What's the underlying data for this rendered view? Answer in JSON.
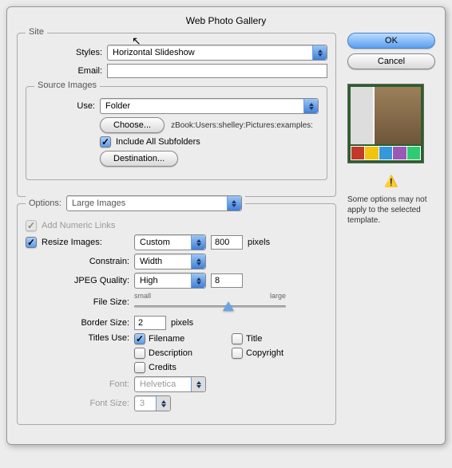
{
  "window_title": "Web Photo Gallery",
  "buttons": {
    "ok": "OK",
    "cancel": "Cancel"
  },
  "site": {
    "legend": "Site",
    "styles_label": "Styles:",
    "styles_value": "Horizontal Slideshow",
    "email_label": "Email:",
    "email_value": ""
  },
  "source": {
    "legend": "Source Images",
    "use_label": "Use:",
    "use_value": "Folder",
    "choose_button": "Choose...",
    "path": "zBook:Users:shelley:Pictures:examples:",
    "include_sub_label": "Include All Subfolders",
    "include_sub_checked": true,
    "destination_button": "Destination..."
  },
  "options": {
    "legend": "Options:",
    "value": "Large Images",
    "add_numeric_label": "Add Numeric Links",
    "resize_label": "Resize Images:",
    "resize_checked": true,
    "resize_value": "Custom",
    "resize_px": "800",
    "pixels": "pixels",
    "constrain_label": "Constrain:",
    "constrain_value": "Width",
    "quality_label": "JPEG Quality:",
    "quality_value": "High",
    "quality_num": "8",
    "filesize_label": "File Size:",
    "slider_small": "small",
    "slider_large": "large",
    "slider_pos_pct": 62,
    "border_label": "Border Size:",
    "border_value": "2",
    "titles_label": "Titles Use:",
    "titles": {
      "filename": {
        "label": "Filename",
        "checked": true
      },
      "title": {
        "label": "Title",
        "checked": false
      },
      "description": {
        "label": "Description",
        "checked": false
      },
      "copyright": {
        "label": "Copyright",
        "checked": false
      },
      "credits": {
        "label": "Credits",
        "checked": false
      }
    },
    "font_label": "Font:",
    "font_value": "Helvetica",
    "fontsize_label": "Font Size:",
    "fontsize_value": "3"
  },
  "warning_text": "Some options may not apply to the selected template."
}
